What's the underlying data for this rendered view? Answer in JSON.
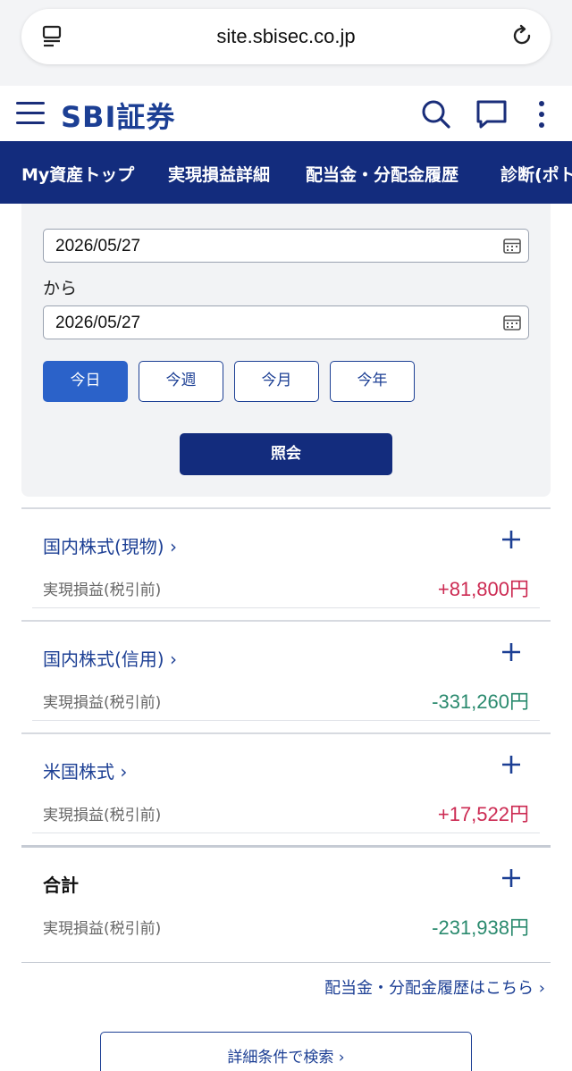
{
  "browser": {
    "url": "site.sbisec.co.jp"
  },
  "header": {
    "logo": "SBI証券"
  },
  "nav": {
    "items": [
      "My資産トップ",
      "実現損益詳細",
      "配当金・分配金履歴",
      "診断(ポト"
    ]
  },
  "filter": {
    "date_from": "2026/05/27",
    "connector": "から",
    "date_to": "2026/05/27",
    "period_buttons": [
      "今日",
      "今週",
      "今月",
      "今年"
    ],
    "active_period": "今日",
    "query_label": "照会"
  },
  "results": [
    {
      "title": "国内株式(現物)",
      "label": "実現損益(税引前)",
      "value": "+81,800円",
      "sign": "positive"
    },
    {
      "title": "国内株式(信用)",
      "label": "実現損益(税引前)",
      "value": "-331,260円",
      "sign": "negative"
    },
    {
      "title": "米国株式",
      "label": "実現損益(税引前)",
      "value": "+17,522円",
      "sign": "positive"
    },
    {
      "title": "合計",
      "label": "実現損益(税引前)",
      "value": "-231,938円",
      "sign": "negative"
    }
  ],
  "links": {
    "dividend_history": "配当金・分配金履歴はこちら",
    "detail_search": "詳細条件で検索"
  },
  "colors": {
    "brand_navy": "#132c7d",
    "accent_blue": "#2b62c9",
    "positive": "#cc2a52",
    "negative": "#2a8a6e"
  },
  "icons": [
    "reader-icon",
    "reload-icon",
    "menu-icon",
    "search-icon",
    "chat-icon",
    "more-icon",
    "calendar-icon",
    "plus-icon",
    "chevron-right-icon"
  ]
}
